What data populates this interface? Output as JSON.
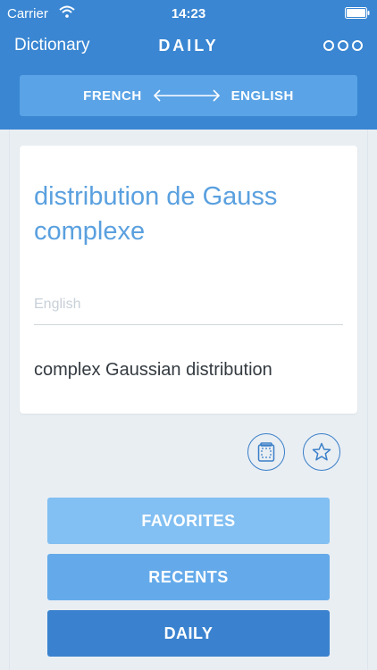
{
  "status_bar": {
    "carrier": "Carrier",
    "time": "14:23"
  },
  "nav": {
    "back_label": "Dictionary",
    "title": "DAILY",
    "more_icon": "more-options-icon"
  },
  "language_switch": {
    "source": "FRENCH",
    "target": "ENGLISH"
  },
  "card": {
    "term": "distribution de Gauss complexe",
    "target_language_label": "English",
    "translation": "complex Gaussian distribution"
  },
  "actions": {
    "copy_icon": "copy-icon",
    "favorite_icon": "star-icon"
  },
  "menu": {
    "favorites": "FAVORITES",
    "recents": "RECENTS",
    "daily": "DAILY"
  },
  "colors": {
    "header": "#3a86d2",
    "language_bar": "#5aa3e6",
    "term_text": "#5aa0df",
    "favorites_button": "#82bff2",
    "recents_button": "#64aaea",
    "daily_button": "#3a82cf",
    "background": "#e9eef3"
  }
}
